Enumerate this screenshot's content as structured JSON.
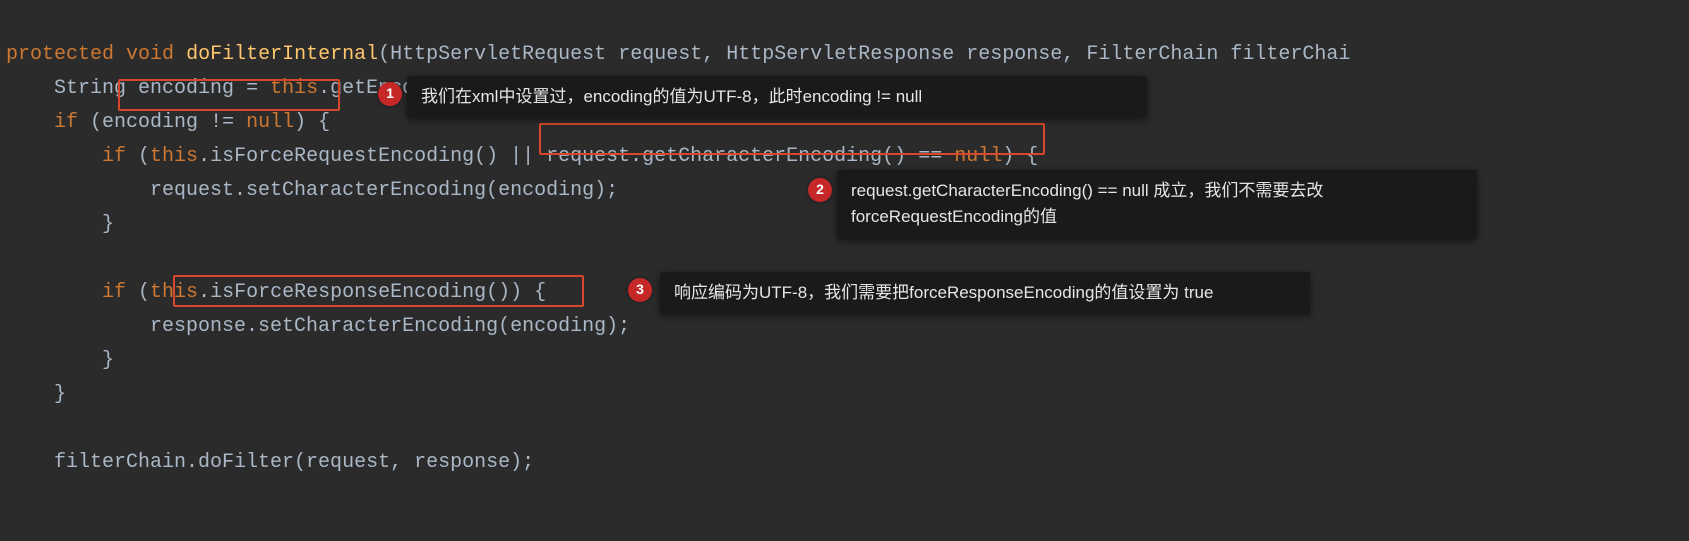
{
  "code": {
    "sig_kw_protected": "protected",
    "sig_kw_void": "void",
    "sig_method": "doFilterInternal",
    "sig_p1_type": "HttpServletRequest",
    "sig_p1_name": "request",
    "sig_p2_type": "HttpServletResponse",
    "sig_p2_name": "response",
    "sig_p3_type": "FilterChain",
    "sig_p3_name": "filterChai",
    "l2_type": "String",
    "l2_var": "encoding",
    "l2_eq": " = ",
    "l2_this": "this",
    "l2_call": ".getEncoding();",
    "l3_if": "if",
    "l3_open": " (",
    "l3_cond1": "encoding",
    "l3_neq": " != ",
    "l3_null": "null",
    "l3_close": ") {",
    "l4_if": "if",
    "l4_open": " (",
    "l4_this": "this",
    "l4_call1": ".isForceRequestEncoding() || ",
    "l4_req": "request",
    "l4_call2": ".getCharacterEncoding() == ",
    "l4_null": "null",
    "l4_close": ") {",
    "l5": "request.setCharacterEncoding(encoding);",
    "l6": "}",
    "l8_if": "if",
    "l8_open": " (",
    "l8_this": "this",
    "l8_call": ".isForceResponseEncoding()",
    "l8_close": ") {",
    "l9": "response.setCharacterEncoding(encoding);",
    "l10": "}",
    "l11": "}",
    "l13": "filterChain.doFilter(request, response);"
  },
  "badges": {
    "one": "1",
    "two": "2",
    "three": "3"
  },
  "notes": {
    "n1": "我们在xml中设置过，encoding的值为UTF-8，此时encoding != null",
    "n2a": "request.getCharacterEncoding() == null 成立，我们不需要去改",
    "n2b": "forceRequestEncoding的值",
    "n3": "响应编码为UTF-8，我们需要把forceResponseEncoding的值设置为 true"
  }
}
